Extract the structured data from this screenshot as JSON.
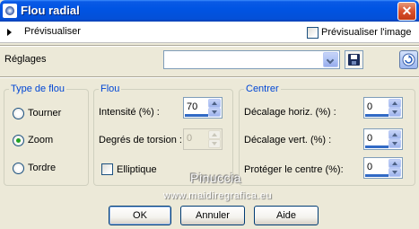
{
  "window": {
    "title": "Flou radial",
    "icon": "app-icon",
    "close_icon": "close-icon",
    "close_glyph": "✕"
  },
  "preview": {
    "label": "Prévisualiser",
    "image_checkbox_label": "Prévisualiser l'image",
    "image_checked": false
  },
  "presets": {
    "label": "Réglages",
    "value": "",
    "save_icon": "save-icon",
    "reset_icon": "reset-icon"
  },
  "blur_type": {
    "title": "Type de flou",
    "options": [
      {
        "label": "Tourner",
        "checked": false
      },
      {
        "label": "Zoom",
        "checked": true
      },
      {
        "label": "Tordre",
        "checked": false
      }
    ]
  },
  "blur": {
    "title": "Flou",
    "intensity": {
      "label": "Intensité (%) :",
      "value": "70"
    },
    "twist": {
      "label": "Degrés de torsion :",
      "value": "0",
      "disabled": true
    },
    "elliptical": {
      "label": "Elliptique",
      "checked": false
    }
  },
  "center": {
    "title": "Centrer",
    "h_offset": {
      "label": "Décalage horiz. (%) :",
      "value": "0"
    },
    "v_offset": {
      "label": "Décalage vert. (%) :",
      "value": "0"
    },
    "protect": {
      "label": "Protéger le centre (%):",
      "value": "0"
    }
  },
  "watermark": {
    "line1": "Pinuccia",
    "line2": "www.maidiregrafica.eu"
  },
  "buttons": {
    "ok": "OK",
    "cancel": "Annuler",
    "help": "Aide"
  }
}
